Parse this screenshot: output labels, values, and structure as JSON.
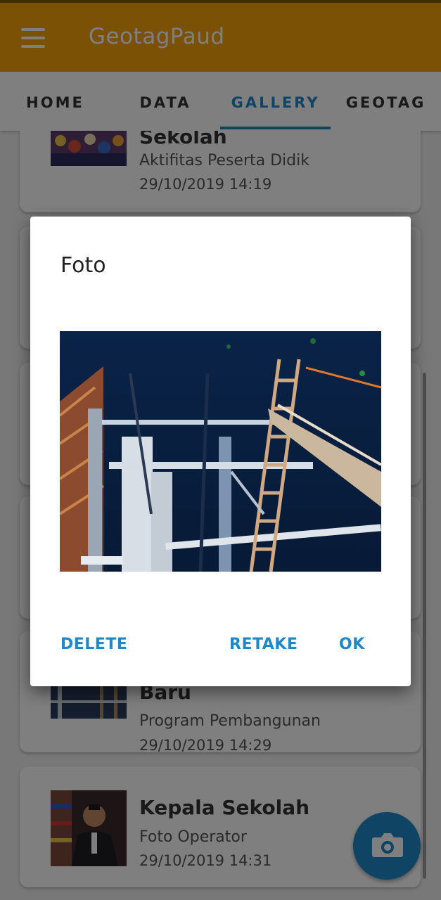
{
  "app": {
    "title": "GeotagPaud",
    "colors": {
      "appbar": "#f5a30b",
      "accent": "#1e88c8"
    }
  },
  "tabs": [
    {
      "label": "HOME",
      "active": false
    },
    {
      "label": "DATA",
      "active": false
    },
    {
      "label": "GALLERY",
      "active": true
    },
    {
      "label": "GEOTAG",
      "active": false
    }
  ],
  "gallery": {
    "items": [
      {
        "title": "Sekolah",
        "subtitle": "Aktifitas Peserta Didik",
        "date": "29/10/2019 14:19"
      },
      {
        "title": "Baru",
        "subtitle": "Program Pembangunan",
        "date": "29/10/2019 14:29"
      },
      {
        "title": "Kepala Sekolah",
        "subtitle": "Foto Operator",
        "date": "29/10/2019 14:31"
      }
    ]
  },
  "fab": {
    "icon": "camera-icon"
  },
  "dialog": {
    "title": "Foto",
    "delete_label": "DELETE",
    "retake_label": "RETAKE",
    "ok_label": "OK"
  }
}
